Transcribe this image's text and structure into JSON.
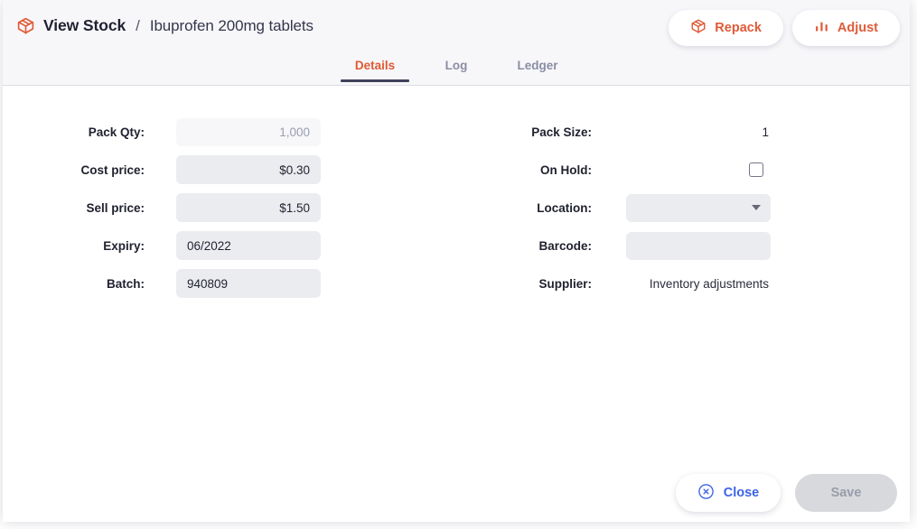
{
  "header": {
    "icon": "package-box-icon",
    "title": "View Stock",
    "separator": "/",
    "subtitle": "Ibuprofen 200mg tablets",
    "actions": [
      {
        "label": "Repack",
        "icon": "package-box-icon"
      },
      {
        "label": "Adjust",
        "icon": "bar-chart-icon"
      }
    ]
  },
  "tabs": [
    {
      "label": "Details",
      "active": true
    },
    {
      "label": "Log",
      "active": false
    },
    {
      "label": "Ledger",
      "active": false
    }
  ],
  "form": {
    "left": [
      {
        "label": "Pack Qty:",
        "value": "1,000",
        "type": "number-readonly"
      },
      {
        "label": "Cost price:",
        "value": "$0.30",
        "type": "number"
      },
      {
        "label": "Sell price:",
        "value": "$1.50",
        "type": "number"
      },
      {
        "label": "Expiry:",
        "value": "06/2022",
        "type": "text"
      },
      {
        "label": "Batch:",
        "value": "940809",
        "type": "text"
      }
    ],
    "right": [
      {
        "label": "Pack Size:",
        "value": "1",
        "type": "plain"
      },
      {
        "label": "On Hold:",
        "value": "",
        "type": "checkbox",
        "checked": false
      },
      {
        "label": "Location:",
        "value": "",
        "type": "select"
      },
      {
        "label": "Barcode:",
        "value": "",
        "type": "text"
      },
      {
        "label": "Supplier:",
        "value": "Inventory adjustments",
        "type": "plain"
      }
    ]
  },
  "footer": {
    "close_label": "Close",
    "close_icon": "circle-x-icon",
    "save_label": "Save"
  },
  "colors": {
    "accent_orange": "#df5b38",
    "tab_underline": "#3f4259",
    "link_blue": "#3b63e8",
    "field_bg": "#ebecef",
    "field_bg_disabled": "#f7f7f9",
    "header_bg": "#f7f7fa",
    "save_disabled_bg": "#d8d9dc"
  }
}
